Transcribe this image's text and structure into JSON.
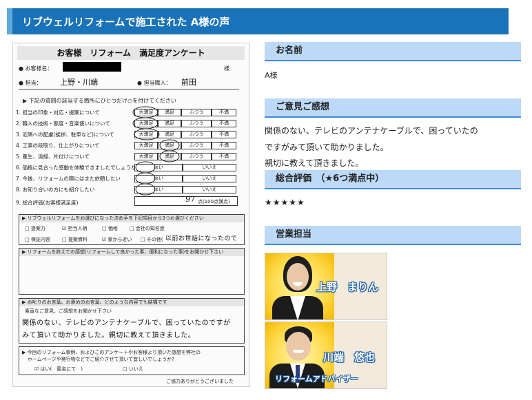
{
  "header": {
    "title": "リブウェルリフォームで施工された A様の声"
  },
  "survey": {
    "title": "お客様　リフォーム　満足度アンケート",
    "customer_label": "● お客様名：",
    "customer_suffix": "様",
    "tanto_label": "● 担当：",
    "tanto_value": "上野・川端",
    "shokunin_label": "● 担当職人：",
    "shokunin_value": "前田",
    "instruction": "▶ 下記の質問の該当する箇所にひとつだけ○を付けてください",
    "questions": [
      "1. 担当の印象・対応・提案について",
      "2. 職人の技術・態度・音楽使いについて",
      "3. 近隣への配慮(挨拶、駐車など)について",
      "4. 工事の段取り、仕上がりについて",
      "5. 養生、清掃、片付けについて",
      "6. 価格に見合った感動を体験できましたでしょうか?",
      "7. 今後、リフォームの際にはまた依頼したい",
      "8. お知り合いの方にも紹介したい",
      "9. 総合評価(お客様満足度)"
    ],
    "scale4": [
      "大満足",
      "満足",
      "ふつう",
      "不満"
    ],
    "scale2": [
      "はい",
      "いいえ"
    ],
    "score_value": "97",
    "score_unit": "点(100点満点)",
    "box1_title": "▶ リブウェルリフォームをお選びになった決め手を下記項目から3つお選びください",
    "box1_options": [
      "□ 提案力",
      "☑ 担当人柄",
      "□ 価格",
      "□ 会社の知名度",
      "□ 保証内容",
      "□ 提案資料",
      "☑ 家から近い",
      "□ その他("
    ],
    "box1_other": "以前お世話になったので",
    "box2_title": "▶ リフォームを終えての感想(リフォームして良かった事、便利になった事)をお聞かせ下さい",
    "box3_title": "▶ お叱りのお言葉、お褒めのお言葉、どのような内容でも結構です",
    "box3_sub": "素直なご意見、ご感想をお聞かせ下さい",
    "box3_hw1": "関係のない、テレビのアンテナケーブルで、困っていたのですが",
    "box3_hw2": "みて頂いて助かりました。親切に教えて頂きました。",
    "box4_title": "▶ 今回のリフォーム事例、およびこのアンケートやお客様より頂いた感想を弊社の",
    "box4_title2": "ホームページや発行物などでご紹介させて頂いて宜しいでしょうか?",
    "box4_yes": "☑ はい(　匿名にて　)",
    "box4_no": "□ いいえ",
    "thanks": "ご協力ありがとうございました"
  },
  "sections": {
    "name_head": "お名前",
    "name_value": "A様",
    "opinion_head": "ご意見ご感想",
    "opinion_lines": [
      "関係のない、テレビのアンテナケーブルで、困っていたの",
      "ですがみて頂いて助かりました。",
      "親切に教えて頂きました。"
    ],
    "rating_head": "総合評価　（★6つ満点中）",
    "rating_stars": "★★★★★",
    "rating_value": 5,
    "rating_max": 6,
    "staff_head": "営業担当"
  },
  "staff": [
    {
      "name": "上野　まりん",
      "role": ""
    },
    {
      "name": "川端　悠也",
      "role": "リフォームアドバイザー"
    }
  ]
}
